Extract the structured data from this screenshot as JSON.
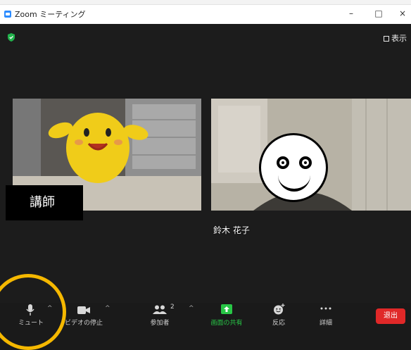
{
  "window": {
    "title": "Zoom ミーティング",
    "minimize": "–",
    "maximize": "□",
    "close": "×"
  },
  "meeting": {
    "view_label": "表示",
    "left_tile": {
      "label": "講師"
    },
    "right_tile": {
      "name": "鈴木 花子"
    }
  },
  "toolbar": {
    "mute": "ミュート",
    "video": "ビデオの停止",
    "participants": "参加者",
    "participants_count": "2",
    "share": "画面の共有",
    "reactions": "反応",
    "more": "詳細",
    "leave": "退出"
  },
  "colors": {
    "share_accent": "#28c646",
    "leave_red": "#e02828",
    "highlight_ring": "#f5b800",
    "shield_green": "#22b24c"
  }
}
